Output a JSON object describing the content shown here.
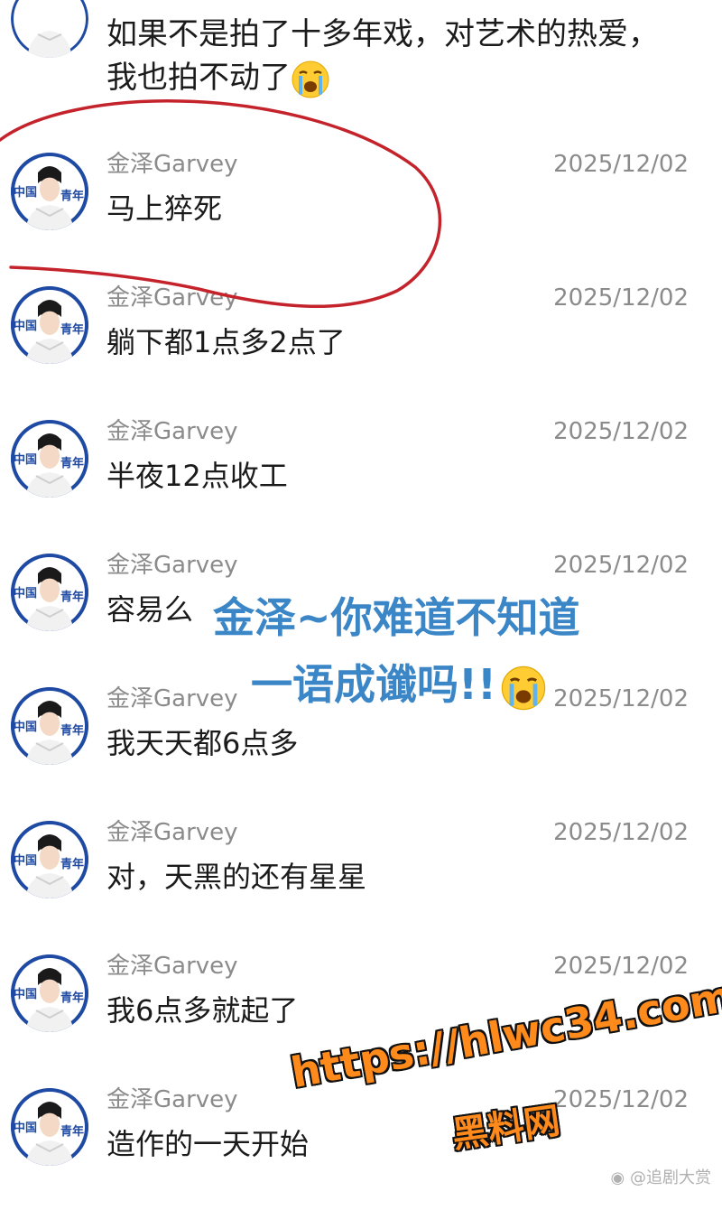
{
  "top_message": {
    "line1": "如果不是拍了十多年戏，对艺术的热爱，",
    "line2": "我也拍不动了"
  },
  "comments": [
    {
      "name": "金泽Garvey",
      "date": "2025/12/02",
      "text": "马上猝死"
    },
    {
      "name": "金泽Garvey",
      "date": "2025/12/02",
      "text": "躺下都1点多2点了"
    },
    {
      "name": "金泽Garvey",
      "date": "2025/12/02",
      "text": "半夜12点收工"
    },
    {
      "name": "金泽Garvey",
      "date": "2025/12/02",
      "text": "容易么"
    },
    {
      "name": "金泽Garvey",
      "date": "2025/12/02",
      "text": "我天天都6点多"
    },
    {
      "name": "金泽Garvey",
      "date": "2025/12/02",
      "text": "对，天黑的还有星星"
    },
    {
      "name": "金泽Garvey",
      "date": "2025/12/02",
      "text": "我6点多就起了"
    },
    {
      "name": "金泽Garvey",
      "date": "2025/12/02",
      "text": "造作的一天开始"
    }
  ],
  "avatar_label": {
    "left": "中国",
    "right": "青年"
  },
  "overlay": {
    "line1": "金泽~你难道不知道",
    "line2": "一语成谶吗!!"
  },
  "watermark": {
    "url": "https://hlwc34.com",
    "site": "黑料网",
    "weibo": "@追剧大赏"
  },
  "colors": {
    "meta_gray": "#8b8b8b",
    "overlay_blue": "#3b86c6",
    "annotation_red": "#c4232b",
    "watermark_orange": "#ff8a1c",
    "avatar_blue": "#1f4aa3"
  },
  "icons": {
    "crying_emoji": "loudly-crying-face-icon",
    "weibo": "weibo-icon"
  }
}
